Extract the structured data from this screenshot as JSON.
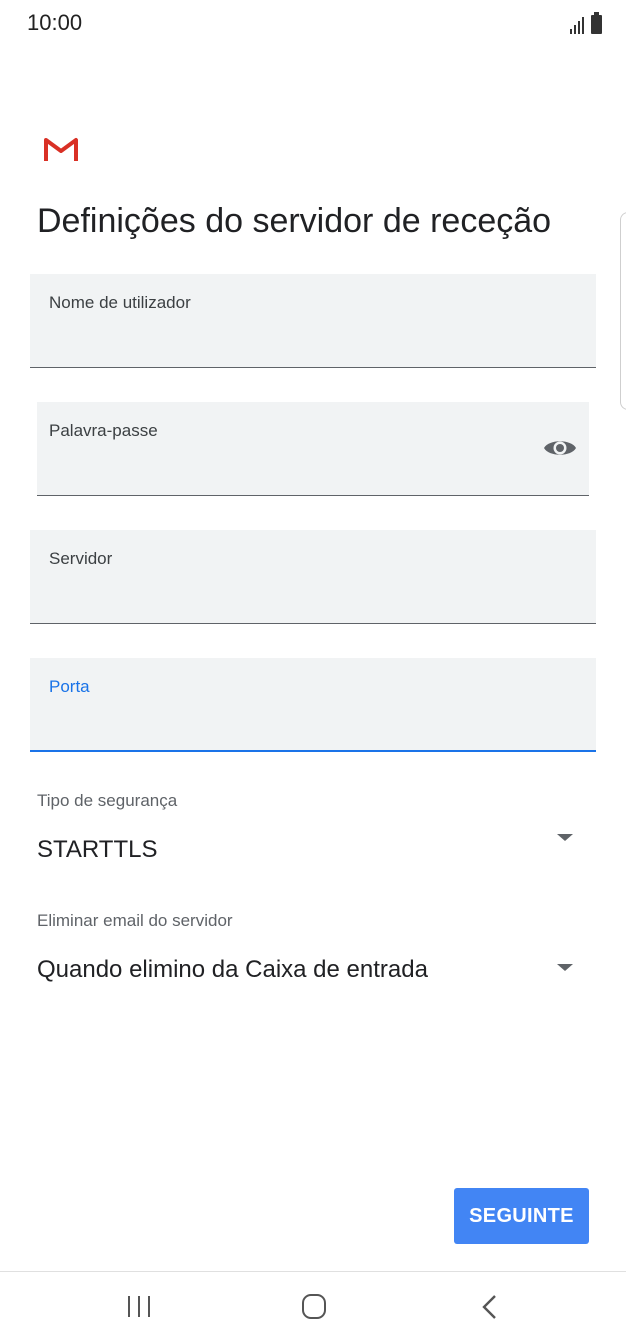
{
  "status_bar": {
    "time": "10:00",
    "icons": [
      "signal-icon",
      "battery-icon"
    ]
  },
  "header": {
    "logo_icon": "gmail-icon",
    "title": "Definições do servidor de receção"
  },
  "form": {
    "username": {
      "label": "Nome de utilizador",
      "value": ""
    },
    "password": {
      "label": "Palavra-passe",
      "value": "",
      "toggle_icon": "eye-icon"
    },
    "server": {
      "label": "Servidor",
      "value": ""
    },
    "port": {
      "label": "Porta",
      "value": "",
      "focused": true
    }
  },
  "security_type": {
    "label": "Tipo de segurança",
    "selected": "STARTTLS"
  },
  "delete_from_server": {
    "label": "Eliminar email do servidor",
    "selected": "Quando elimino da Caixa de entrada"
  },
  "actions": {
    "next_label": "SEGUINTE"
  },
  "colors": {
    "accent": "#1a73e8",
    "button": "#4285f4",
    "field_bg": "#f1f3f4",
    "gmail_red": "#d93025"
  },
  "nav_bar": {
    "icons": [
      "recents-icon",
      "home-icon",
      "back-icon"
    ]
  }
}
